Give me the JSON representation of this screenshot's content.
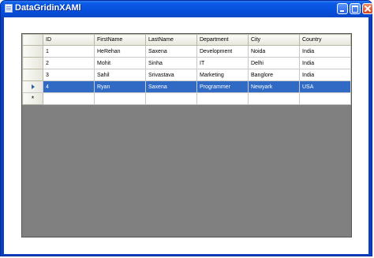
{
  "window": {
    "title": "DataGridinXAMl",
    "title_color": "#ffffff",
    "titlebar_color": "#0750dd"
  },
  "titlebar": {
    "buttons": [
      "minimize-icon",
      "maximize-icon",
      "close-icon"
    ]
  },
  "grid": {
    "background": "#808080",
    "selection_color": "#316ac5",
    "columns": [
      "ID",
      "FirstName",
      "LastName",
      "Department",
      "City",
      "Country"
    ],
    "rows": [
      {
        "id": "1",
        "first": "HeRehan",
        "last": "Saxena",
        "dept": "Development",
        "city": "Noida",
        "country": "India"
      },
      {
        "id": "2",
        "first": "Mohit",
        "last": "Sinha",
        "dept": "IT",
        "city": "Delhi",
        "country": "India"
      },
      {
        "id": "3",
        "first": "Sahil",
        "last": "Srivastava",
        "dept": "Marketing",
        "city": "Banglore",
        "country": "India"
      },
      {
        "id": "4",
        "first": "Ryan",
        "last": "Saxena",
        "dept": "Programmer",
        "city": "Newyark",
        "country": "USA"
      }
    ],
    "selected_row_index": 3,
    "current_row_marker": "arrow-icon",
    "new_row_marker": "*"
  }
}
